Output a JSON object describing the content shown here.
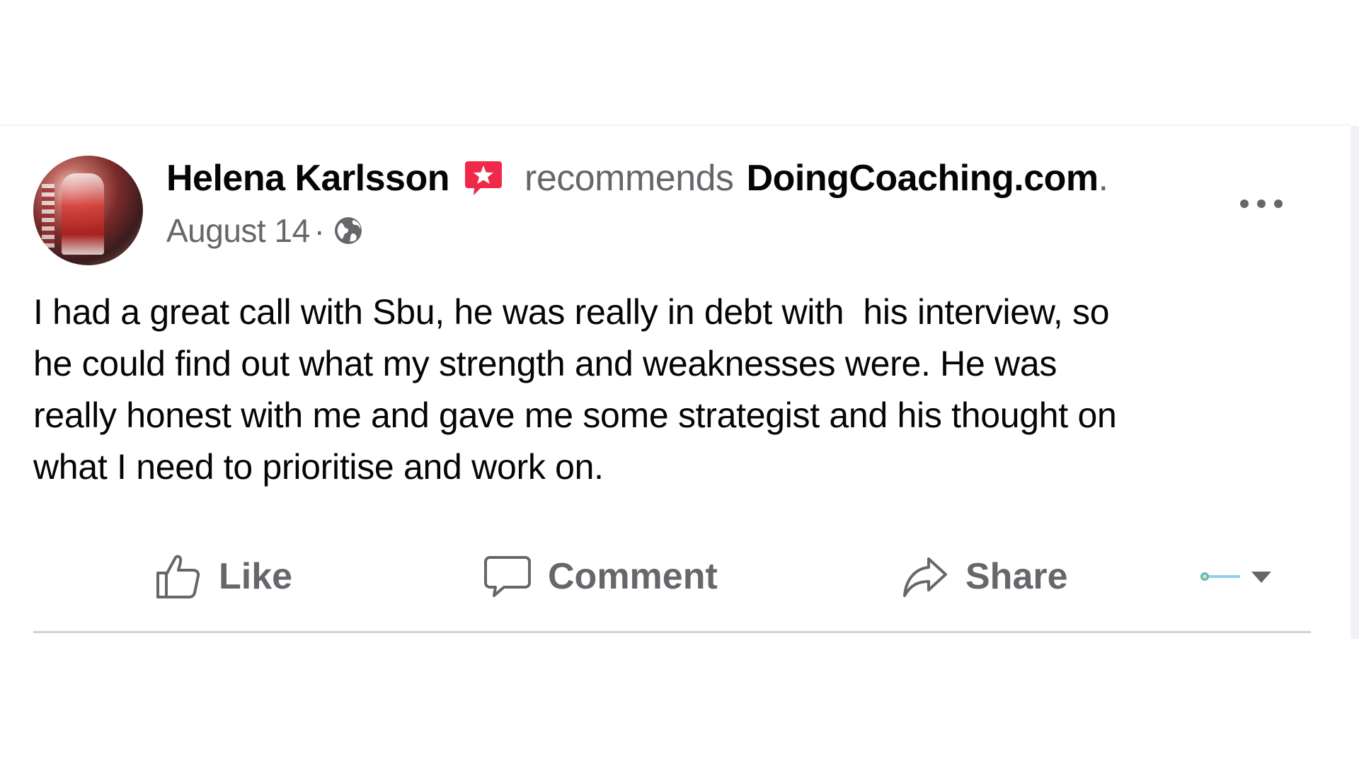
{
  "post": {
    "author": "Helena Karlsson",
    "recommends_label": "recommends",
    "page_name": "DoingCoaching.com",
    "page_name_suffix": ".",
    "date": "August 14",
    "date_separator": "·",
    "audience_icon": "globe-icon",
    "more_icon": "more-options-icon",
    "text": "I had a great call with Sbu, he was really in debt with  his interview, so\nhe could find out what my strength and weaknesses were. He was\nreally honest with me and gave me some strategist and his thought on\nwhat I need to prioritise and work on."
  },
  "actions": {
    "like_label": "Like",
    "comment_label": "Comment",
    "share_label": "Share",
    "like_icon": "thumbs-up-icon",
    "comment_icon": "speech-bubble-icon",
    "share_icon": "share-arrow-icon",
    "audience_selector_icon": "chevron-down-icon"
  },
  "colors": {
    "primary_text": "#050505",
    "secondary_text": "#65676b",
    "recommend_badge": "#f02849",
    "divider": "#ced0d4"
  }
}
